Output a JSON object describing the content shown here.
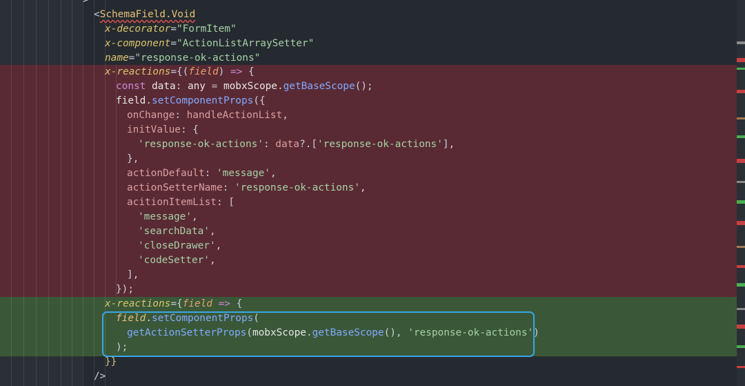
{
  "editor": {
    "lines": [
      {
        "tokens": [
          [
            "tk-punc",
            ">"
          ]
        ]
      },
      {
        "tokens": [
          [
            "tk-punc",
            "<"
          ],
          [
            "tk-tag squiggle",
            "SchemaField.Void"
          ]
        ]
      },
      {
        "tokens": [
          [
            "tk-attr",
            "x-decorator"
          ],
          [
            "tk-punc",
            "="
          ],
          [
            "tk-str",
            "\"FormItem\""
          ]
        ]
      },
      {
        "tokens": [
          [
            "tk-attr",
            "x-component"
          ],
          [
            "tk-punc",
            "="
          ],
          [
            "tk-str",
            "\"ActionListArraySetter\""
          ]
        ]
      },
      {
        "tokens": [
          [
            "tk-attr",
            "name"
          ],
          [
            "tk-punc",
            "="
          ],
          [
            "tk-str",
            "\"response-ok-actions\""
          ]
        ]
      },
      {
        "tokens": [
          [
            "tk-attr",
            "x-reactions"
          ],
          [
            "tk-punc",
            "={("
          ],
          [
            "tk-param",
            "field"
          ],
          [
            "tk-punc",
            ") "
          ],
          [
            "tk-kw",
            "=>"
          ],
          [
            "tk-punc",
            " {"
          ]
        ]
      },
      {
        "tokens": [
          [
            "tk-kw",
            "const"
          ],
          [
            "tk-var",
            " data"
          ],
          [
            "tk-punc",
            ": "
          ],
          [
            "tk-var",
            "any"
          ],
          [
            "tk-op",
            " = "
          ],
          [
            "tk-var",
            "mobxScope"
          ],
          [
            "tk-punc",
            "."
          ],
          [
            "tk-fn",
            "getBaseScope"
          ],
          [
            "tk-punc",
            "();"
          ]
        ]
      },
      {
        "tokens": [
          [
            "tk-var",
            "field"
          ],
          [
            "tk-punc",
            "."
          ],
          [
            "tk-fn",
            "setComponentProps"
          ],
          [
            "tk-punc",
            "({"
          ]
        ]
      },
      {
        "tokens": [
          [
            "tk-prop",
            "onChange"
          ],
          [
            "tk-punc",
            ": "
          ],
          [
            "tk-prop",
            "handleActionList"
          ],
          [
            "tk-punc",
            ","
          ]
        ]
      },
      {
        "tokens": [
          [
            "tk-prop",
            "initValue"
          ],
          [
            "tk-punc",
            ": {"
          ]
        ]
      },
      {
        "tokens": [
          [
            "tk-str",
            "'response-ok-actions'"
          ],
          [
            "tk-punc",
            ": "
          ],
          [
            "tk-prop",
            "data"
          ],
          [
            "tk-punc",
            "?.["
          ],
          [
            "tk-str",
            "'response-ok-actions'"
          ],
          [
            "tk-punc",
            "],"
          ]
        ]
      },
      {
        "tokens": [
          [
            "tk-punc",
            "},"
          ]
        ]
      },
      {
        "tokens": [
          [
            "tk-prop",
            "actionDefault"
          ],
          [
            "tk-punc",
            ": "
          ],
          [
            "tk-str",
            "'message'"
          ],
          [
            "tk-punc",
            ","
          ]
        ]
      },
      {
        "tokens": [
          [
            "tk-prop",
            "actionSetterName"
          ],
          [
            "tk-punc",
            ": "
          ],
          [
            "tk-str",
            "'response-ok-actions'"
          ],
          [
            "tk-punc",
            ","
          ]
        ]
      },
      {
        "tokens": [
          [
            "tk-prop",
            "acitionItemList"
          ],
          [
            "tk-punc",
            ": ["
          ]
        ]
      },
      {
        "tokens": [
          [
            "tk-str",
            "'message'"
          ],
          [
            "tk-punc",
            ","
          ]
        ]
      },
      {
        "tokens": [
          [
            "tk-str",
            "'searchData'"
          ],
          [
            "tk-punc",
            ","
          ]
        ]
      },
      {
        "tokens": [
          [
            "tk-str",
            "'closeDrawer'"
          ],
          [
            "tk-punc",
            ","
          ]
        ]
      },
      {
        "tokens": [
          [
            "tk-str",
            "'codeSetter'"
          ],
          [
            "tk-punc",
            ","
          ]
        ]
      },
      {
        "tokens": [
          [
            "tk-punc",
            "],"
          ]
        ]
      },
      {
        "tokens": [
          [
            "tk-punc",
            "});"
          ]
        ]
      },
      {
        "tokens": [
          [
            "tk-attr",
            "x-reactions"
          ],
          [
            "tk-punc",
            "={"
          ],
          [
            "tk-param",
            "field"
          ],
          [
            "tk-punc",
            " "
          ],
          [
            "tk-kw",
            "=>"
          ],
          [
            "tk-punc",
            " {"
          ]
        ]
      },
      {
        "tokens": [
          [
            "tk-field",
            "field"
          ],
          [
            "tk-punc",
            "."
          ],
          [
            "tk-fn",
            "setComponentProps"
          ],
          [
            "tk-punc",
            "("
          ]
        ]
      },
      {
        "tokens": [
          [
            "tk-fn",
            "getActionSetterProps"
          ],
          [
            "tk-punc",
            "("
          ],
          [
            "tk-var",
            "mobxScope"
          ],
          [
            "tk-punc",
            "."
          ],
          [
            "tk-fn",
            "getBaseScope"
          ],
          [
            "tk-punc",
            "(), "
          ],
          [
            "tk-str",
            "'response-ok-actions'"
          ],
          [
            "tk-punc",
            ")"
          ]
        ]
      },
      {
        "tokens": [
          [
            "tk-punc",
            ");"
          ]
        ]
      },
      {
        "tokens": [
          [
            "tk-brace",
            "}}"
          ]
        ]
      },
      {
        "tokens": [
          [
            "tk-punc",
            "/>"
          ]
        ]
      }
    ]
  },
  "colors": {
    "background": "#252a30",
    "removed_band": "#5a2a34",
    "added_band": "#3a5838",
    "selection_border": "#3aa6e8"
  }
}
